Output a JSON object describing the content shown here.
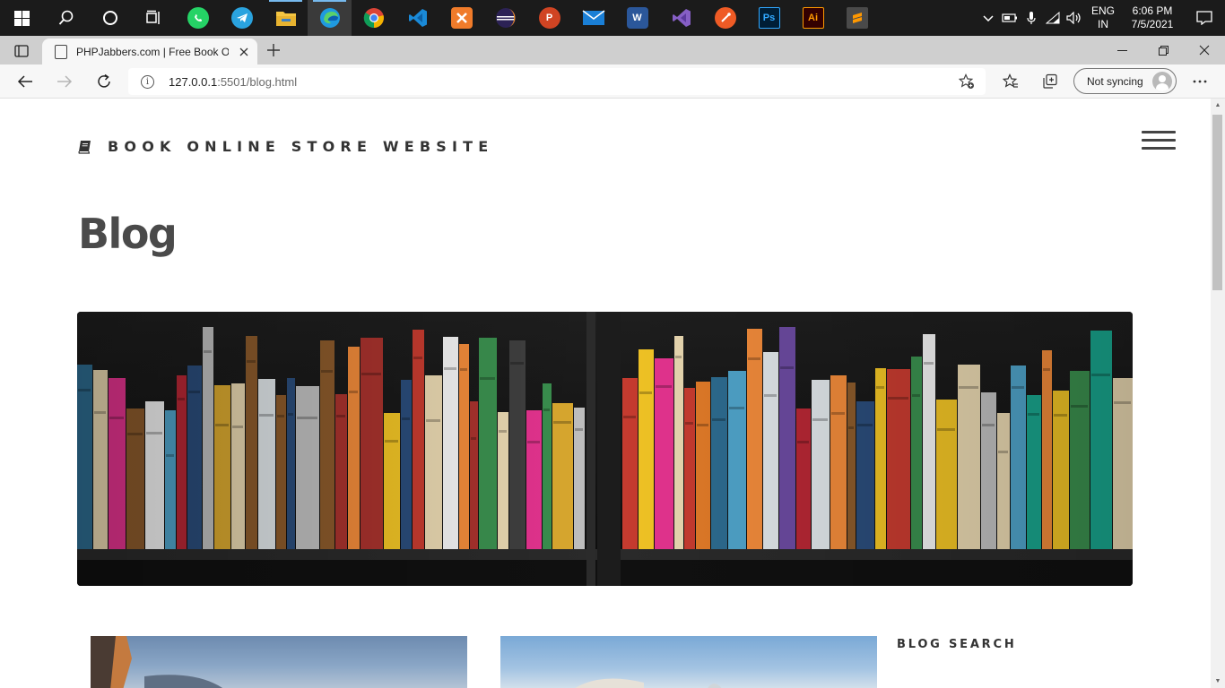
{
  "taskbar": {
    "apps": [
      {
        "name": "start-icon"
      },
      {
        "name": "search-icon"
      },
      {
        "name": "cortana-icon"
      },
      {
        "name": "task-view-icon"
      },
      {
        "name": "whatsapp-icon",
        "color": "#25d366"
      },
      {
        "name": "telegram-icon",
        "color": "#2aa3df"
      },
      {
        "name": "file-explorer-icon",
        "color": "#f4c542"
      },
      {
        "name": "edge-icon",
        "color": "#1f9ae0"
      },
      {
        "name": "chrome-icon",
        "color": "#db4437"
      },
      {
        "name": "vscode-icon",
        "color": "#1a8ad8"
      },
      {
        "name": "xampp-icon",
        "color": "#f07b2a"
      },
      {
        "name": "eclipse-icon",
        "color": "#2c2255"
      },
      {
        "name": "powerpoint-icon",
        "color": "#d04423",
        "label": "P"
      },
      {
        "name": "mail-icon",
        "color": "#1a7fd6"
      },
      {
        "name": "word-icon",
        "color": "#2b579a",
        "label": "W"
      },
      {
        "name": "visual-studio-icon",
        "color": "#865fc5"
      },
      {
        "name": "postman-icon",
        "color": "#ef5b25"
      },
      {
        "name": "photoshop-icon",
        "color": "#31a8ff",
        "label": "Ps"
      },
      {
        "name": "illustrator-icon",
        "color": "#ff9a00",
        "label": "Ai"
      },
      {
        "name": "sublime-icon",
        "color": "#ff9800"
      }
    ],
    "tray": {
      "lang_line1": "ENG",
      "lang_line2": "IN",
      "time": "6:06 PM",
      "date": "7/5/2021"
    }
  },
  "browser": {
    "tab_title": "PHPJabbers.com | Free Book Online Store Website",
    "url_host": "127.0.0.1",
    "url_path": ":5501/blog.html",
    "sync_label": "Not syncing"
  },
  "page": {
    "brand": "BOOK ONLINE STORE WEBSITE",
    "title": "Blog",
    "sidebar_heading": "BLOG SEARCH"
  },
  "colors": {
    "taskbar_bg": "#1b1b1b",
    "tabstrip_bg": "#cfcfcf",
    "brand_text": "#333333",
    "title_text": "#4a4a4a"
  }
}
